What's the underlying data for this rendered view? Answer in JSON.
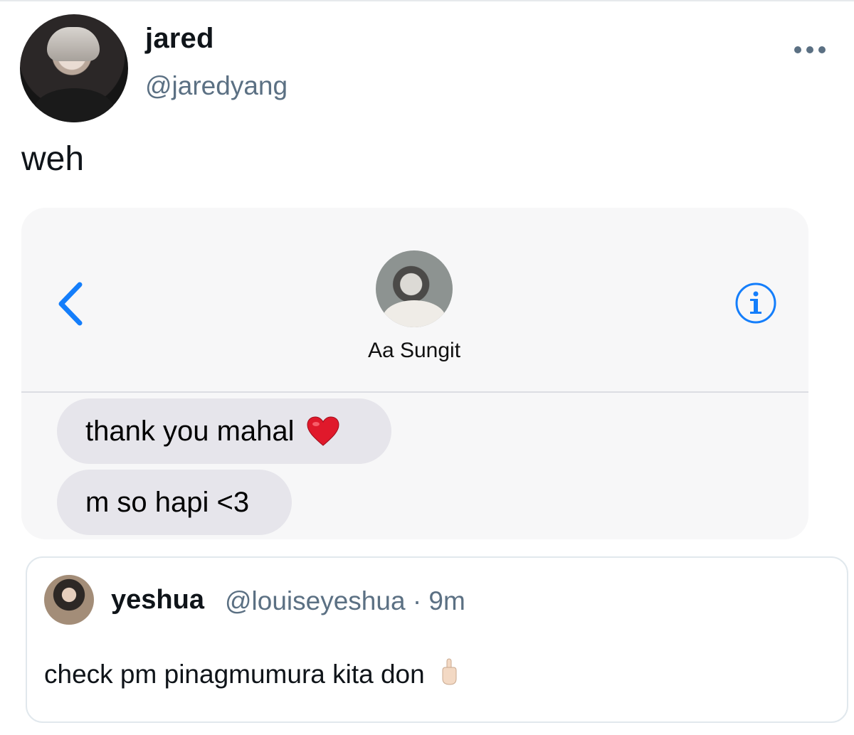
{
  "tweet": {
    "display_name": "jared",
    "handle": "@jaredyang",
    "text": "weh",
    "more_icon": "more-horizontal-icon"
  },
  "imessage": {
    "contact_name": "Aa Sungit",
    "back_icon": "chevron-left-icon",
    "info_icon": "info-icon",
    "accent": "#147efb",
    "bubble_color": "#e6e5eb",
    "messages": [
      {
        "text": "thank you mahal",
        "emoji": "heart-icon"
      },
      {
        "text": "m so hapi <3"
      }
    ]
  },
  "quote": {
    "display_name": "yeshua",
    "meta": "@louiseyeshua · 9m",
    "text": "check pm pinagmumura kita don",
    "emoji": "middle-finger-icon"
  },
  "colors": {
    "secondary_text": "#5b7083",
    "primary_text": "#0f1419",
    "border": "#e1e8ed"
  }
}
